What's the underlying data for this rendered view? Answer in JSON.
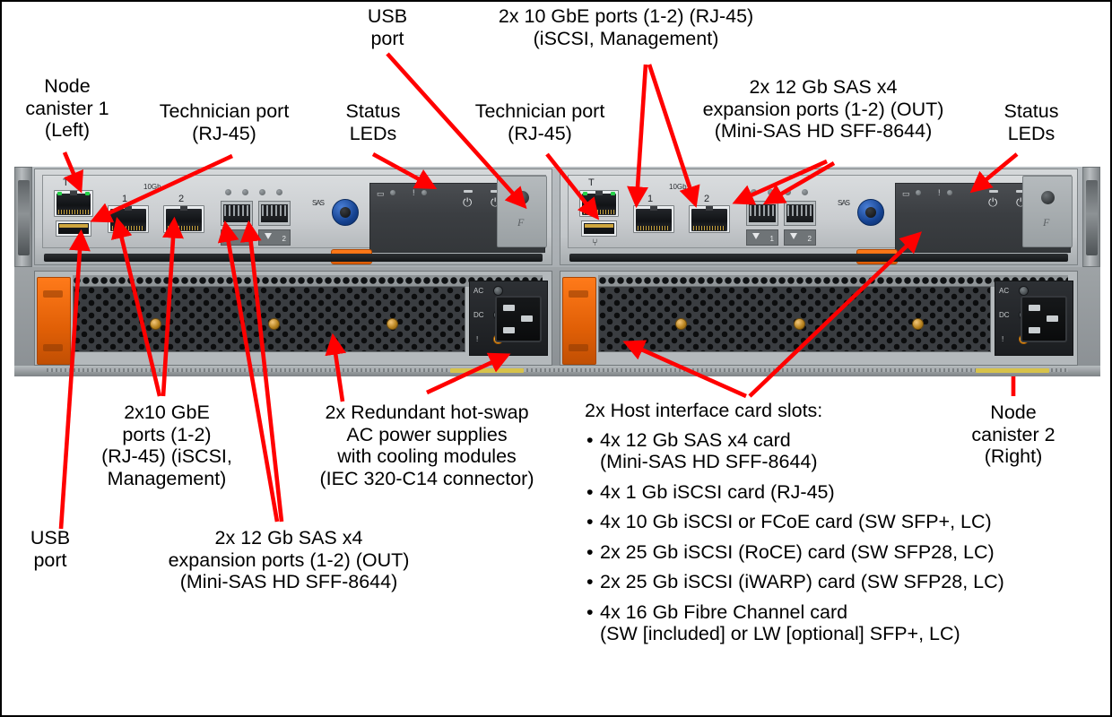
{
  "diagram": {
    "title": "Storage enclosure rear view with node canisters and power supplies",
    "accent_color": "#ff0000",
    "photo_alt": "Rear view of a 2U storage control enclosure"
  },
  "callouts_top": [
    {
      "id": "node-canister-1",
      "text": "Node\ncanister 1\n(Left)"
    },
    {
      "id": "technician-port-left",
      "text": "Technician port\n(RJ-45)"
    },
    {
      "id": "status-leds-left",
      "text": "Status\nLEDs"
    },
    {
      "id": "usb-port-top",
      "text": "USB\nport"
    },
    {
      "id": "technician-port-right",
      "text": "Technician port\n(RJ-45)"
    },
    {
      "id": "gbe-ports-top",
      "text": "2x 10 GbE ports (1-2) (RJ-45)\n(iSCSI, Management)"
    },
    {
      "id": "sas-expansion-top",
      "text": "2x 12 Gb SAS x4\nexpansion ports (1-2) (OUT)\n(Mini-SAS HD SFF-8644)"
    },
    {
      "id": "status-leds-right",
      "text": "Status\nLEDs"
    }
  ],
  "callouts_bottom": [
    {
      "id": "gbe-ports-bottom",
      "text": "2x10 GbE\nports (1-2)\n(RJ-45) (iSCSI,\nManagement)"
    },
    {
      "id": "power-supplies",
      "text": "2x Redundant hot-swap\nAC power supplies\nwith cooling modules\n(IEC 320-C14 connector)"
    },
    {
      "id": "usb-port-bottom",
      "text": "USB\nport"
    },
    {
      "id": "sas-expansion-bottom",
      "text": "2x 12 Gb SAS x4\nexpansion ports (1-2) (OUT)\n(Mini-SAS HD SFF-8644)"
    },
    {
      "id": "node-canister-2",
      "text": "Node\ncanister 2\n(Right)"
    }
  ],
  "host_interface_cards": {
    "heading": "2x Host interface card slots:",
    "items": [
      "4x 12 Gb SAS x4 card\n(Mini-SAS HD SFF-8644)",
      "4x 1 Gb iSCSI card (RJ-45)",
      "4x 10 Gb iSCSI or FCoE card (SW SFP+, LC)",
      "2x 25 Gb iSCSI (RoCE) card (SW SFP28, LC)",
      "2x 25 Gb iSCSI (iWARP) card (SW SFP28, LC)",
      "4x 16 Gb Fibre Channel card\n(SW [included] or LW [optional] SFP+, LC)"
    ]
  },
  "hardware_markings": {
    "technician_label": "T",
    "speed_label": "10Gb",
    "port1": "1",
    "port2": "2",
    "sas_port1": "1",
    "sas_port2": "2",
    "sas_text": "SAS",
    "usb_glyph": "⑂",
    "ac_label": "AC",
    "dc_label": "DC",
    "fault_glyph": "!",
    "power_glyph": "⏻",
    "battery_glyph": "▭",
    "latch_glyph": "F"
  }
}
